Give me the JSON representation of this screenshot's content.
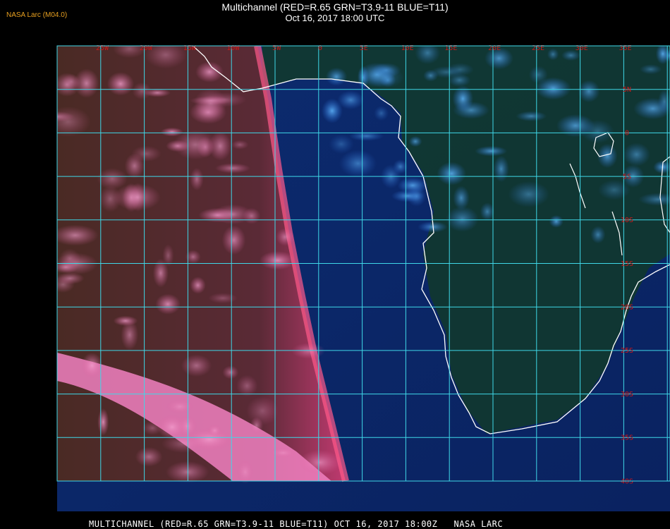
{
  "header": {
    "credit": "NASA Larc (M04.0)",
    "title_line1": "Multichannel (RED=R.65 GRN=T3.9-11 BLUE=T11)",
    "title_line2": "Oct 16, 2017 18:00 UTC"
  },
  "map": {
    "longitude_labels": [
      "25W",
      "20W",
      "15W",
      "10W",
      "5W",
      "0",
      "5E",
      "10E",
      "15E",
      "20E",
      "25E",
      "30E",
      "35E"
    ],
    "latitude_labels": [
      "5N",
      "0",
      "5S",
      "10S",
      "15S",
      "20S",
      "25S",
      "30S",
      "35S",
      "40S"
    ],
    "colors": {
      "grid": "#3fd8e8",
      "label": "#d01818",
      "coast": "#ffffff",
      "ocean_west": "#6a2238",
      "ocean_east": "#0c2a6a",
      "land": "#0e3a1c",
      "clouds_west": "#f070b0",
      "clouds_east": "#3a8ef0"
    }
  },
  "footer": {
    "text": "MULTICHANNEL (RED=R.65 GRN=T3.9-11 BLUE=T11) OCT 16, 2017 18:00Z   NASA LARC"
  }
}
